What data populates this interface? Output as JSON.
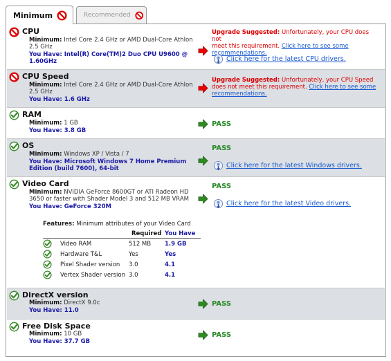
{
  "tabs": [
    {
      "label": "Minimum",
      "active": true
    },
    {
      "label": "Recommended",
      "active": false
    }
  ],
  "colors": {
    "fail": "#d00000",
    "pass": "#2a8a2a",
    "link": "#1a5ad0",
    "have": "#1a1aa6",
    "gray_row": "#dcdfe4"
  },
  "rows": {
    "cpu": {
      "title": "CPU",
      "min_label": "Minimum:",
      "min_value": "Intel Core 2.4 GHz or AMD Dual-Core Athlon",
      "min_value2": "2.5 GHz",
      "have_label": "You Have:",
      "have_value": "Intel(R) Core(TM)2 Duo CPU U9600 @",
      "have_value2": "1.60GHz",
      "status_label": "Upgrade Suggested:",
      "status_text1": " Unfortunately, your CPU does not",
      "status_text2": "meet this requirement. ",
      "status_link1": "Click here to see some",
      "status_link2": "recommendations.",
      "driver_link": "Click here for the latest CPU drivers."
    },
    "cpu_speed": {
      "title": "CPU Speed",
      "min_label": "Minimum:",
      "min_value": "Intel Core 2.4 GHz or AMD Dual-Core Athlon",
      "min_value2": "2.5 GHz",
      "have_label": "You Have:",
      "have_value": "1.6 GHz",
      "status_label": "Upgrade Suggested:",
      "status_text1": " Unfortunately, your CPU Speed",
      "status_text2": "does not meet this requirement. ",
      "status_link1": "Click here to see some",
      "status_link2": "recommendations."
    },
    "ram": {
      "title": "RAM",
      "min_label": "Minimum:",
      "min_value": "1 GB",
      "have_label": "You Have:",
      "have_value": "3.8 GB",
      "status": "PASS"
    },
    "os": {
      "title": "OS",
      "min_label": "Minimum:",
      "min_value": "Windows XP / Vista / 7",
      "have_label": "You Have:",
      "have_value": "Microsoft Windows 7 Home Premium",
      "have_value2": "Edition (build 7600), 64-bit",
      "status": "PASS",
      "driver_link": "Click here for the latest Windows drivers."
    },
    "video": {
      "title": "Video Card",
      "min_label": "Minimum:",
      "min_value": "NVIDIA GeForce 8600GT or ATI Radeon HD",
      "min_value2": "3650 or faster with Shader Model 3 and 512 MB VRAM",
      "have_label": "You Have:",
      "have_value": "GeForce 320M",
      "status": "PASS",
      "driver_link": "Click here for the latest Video drivers.",
      "features_label": "Features:",
      "features_text": "Minimum attributes of your Video Card",
      "col_required": "Required",
      "col_have": "You Have",
      "features": [
        {
          "name": "Video RAM",
          "required": "512 MB",
          "have": "1.9 GB"
        },
        {
          "name": "Hardware T&L",
          "required": "Yes",
          "have": "Yes"
        },
        {
          "name": "Pixel Shader version",
          "required": "3.0",
          "have": "4.1"
        },
        {
          "name": "Vertex Shader version",
          "required": "3.0",
          "have": "4.1"
        }
      ]
    },
    "directx": {
      "title": "DirectX version",
      "min_label": "Minimum:",
      "min_value": "DirectX 9.0c",
      "have_label": "You Have:",
      "have_value": "11.0",
      "status": "PASS"
    },
    "disk": {
      "title": "Free Disk Space",
      "min_label": "Minimum:",
      "min_value": "10 GB",
      "have_label": "You Have:",
      "have_value": "37.7 GB",
      "status": "PASS"
    }
  }
}
